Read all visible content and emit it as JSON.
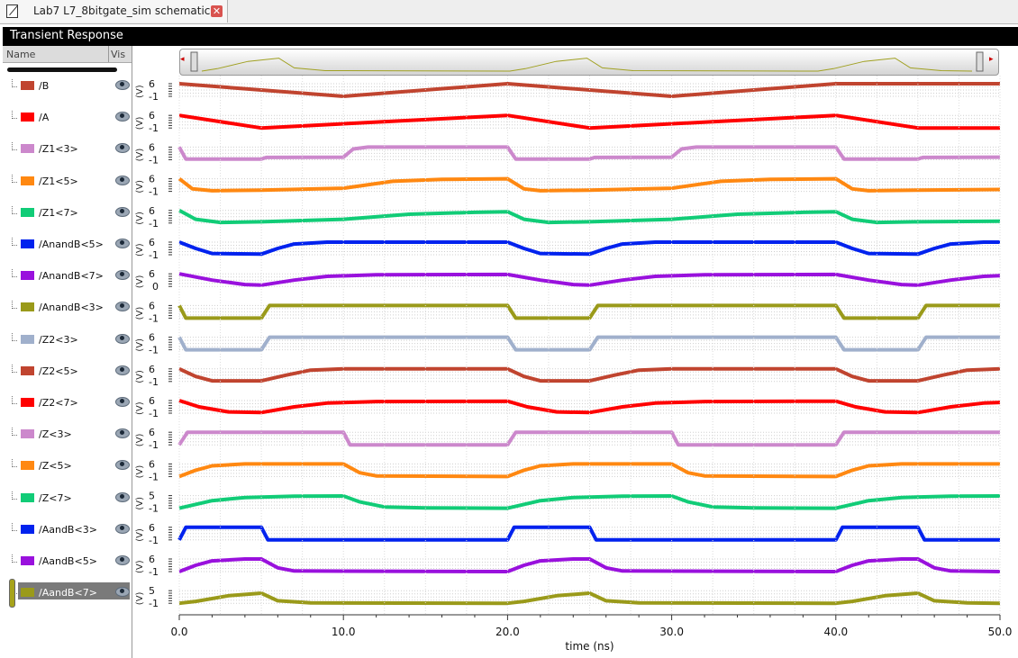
{
  "tab": {
    "title": "Lab7 L7_8bitgate_sim schematic",
    "close_label": "✕"
  },
  "panel": {
    "title": "Transient Response"
  },
  "sidebar": {
    "name_header": "Name",
    "vis_header": "Vis"
  },
  "overview": {
    "left_arrow": "◂",
    "right_arrow": "▸"
  },
  "y_unit": "(V)",
  "signals": [
    {
      "label": "/B",
      "color": "#c0442f",
      "ytick_top": "6",
      "ytick_bot": "-1",
      "kind": "digital",
      "wave": [
        [
          0,
          1
        ],
        [
          10,
          0
        ],
        [
          20,
          1
        ],
        [
          30,
          0
        ],
        [
          40,
          1
        ],
        [
          50,
          1
        ]
      ]
    },
    {
      "label": "/A",
      "color": "#ff0000",
      "ytick_top": "6",
      "ytick_bot": "-1",
      "kind": "digital",
      "wave": [
        [
          0,
          1
        ],
        [
          5,
          0
        ],
        [
          20,
          1
        ],
        [
          25,
          0
        ],
        [
          40,
          1
        ],
        [
          45,
          0
        ],
        [
          50,
          0
        ]
      ]
    },
    {
      "label": "/Z1<3>",
      "color": "#cc88cc",
      "ytick_top": "6",
      "ytick_bot": "-1",
      "kind": "analog",
      "wave": [
        [
          0,
          1
        ],
        [
          0.4,
          0.05
        ],
        [
          5,
          0.05
        ],
        [
          5.3,
          0.18
        ],
        [
          10,
          0.2
        ],
        [
          10.6,
          0.85
        ],
        [
          11.5,
          1
        ],
        [
          20,
          1
        ],
        [
          20.5,
          0.05
        ],
        [
          25,
          0.05
        ],
        [
          25.3,
          0.18
        ],
        [
          30,
          0.2
        ],
        [
          30.6,
          0.85
        ],
        [
          31.5,
          1
        ],
        [
          40,
          1
        ],
        [
          40.5,
          0.05
        ],
        [
          45,
          0.05
        ],
        [
          45.3,
          0.18
        ],
        [
          50,
          0.2
        ]
      ]
    },
    {
      "label": "/Z1<5>",
      "color": "#ff8811",
      "ytick_top": "6",
      "ytick_bot": "-1",
      "kind": "analog",
      "wave": [
        [
          0,
          1
        ],
        [
          0.8,
          0.2
        ],
        [
          2,
          0.05
        ],
        [
          5,
          0.1
        ],
        [
          10,
          0.25
        ],
        [
          13,
          0.8
        ],
        [
          16,
          0.95
        ],
        [
          20,
          1
        ],
        [
          21,
          0.2
        ],
        [
          22,
          0.05
        ],
        [
          25,
          0.1
        ],
        [
          30,
          0.25
        ],
        [
          33,
          0.8
        ],
        [
          36,
          0.95
        ],
        [
          40,
          1
        ],
        [
          41,
          0.2
        ],
        [
          42,
          0.05
        ],
        [
          45,
          0.1
        ],
        [
          50,
          0.15
        ]
      ]
    },
    {
      "label": "/Z1<7>",
      "color": "#11cc77",
      "ytick_top": "6",
      "ytick_bot": "-1",
      "kind": "analog",
      "wave": [
        [
          0,
          1
        ],
        [
          1,
          0.3
        ],
        [
          2.5,
          0.05
        ],
        [
          5,
          0.1
        ],
        [
          10,
          0.3
        ],
        [
          14,
          0.7
        ],
        [
          18,
          0.85
        ],
        [
          20,
          0.9
        ],
        [
          21,
          0.3
        ],
        [
          22.5,
          0.05
        ],
        [
          25,
          0.1
        ],
        [
          30,
          0.3
        ],
        [
          34,
          0.7
        ],
        [
          38,
          0.85
        ],
        [
          40,
          0.9
        ],
        [
          41,
          0.3
        ],
        [
          42.5,
          0.05
        ],
        [
          45,
          0.1
        ],
        [
          50,
          0.15
        ]
      ]
    },
    {
      "label": "/AnandB<5>",
      "color": "#0022ee",
      "ytick_top": "6",
      "ytick_bot": "-1",
      "kind": "analog",
      "wave": [
        [
          0,
          1
        ],
        [
          1,
          0.5
        ],
        [
          2,
          0.1
        ],
        [
          5,
          0.05
        ],
        [
          6,
          0.5
        ],
        [
          7,
          0.85
        ],
        [
          9,
          1
        ],
        [
          20,
          1
        ],
        [
          21,
          0.5
        ],
        [
          22,
          0.1
        ],
        [
          25,
          0.05
        ],
        [
          26,
          0.5
        ],
        [
          27,
          0.85
        ],
        [
          29,
          1
        ],
        [
          40,
          1
        ],
        [
          41,
          0.5
        ],
        [
          42,
          0.1
        ],
        [
          45,
          0.05
        ],
        [
          46,
          0.5
        ],
        [
          47,
          0.85
        ],
        [
          49,
          1
        ],
        [
          50,
          1
        ]
      ]
    },
    {
      "label": "/AnandB<7>",
      "color": "#9911dd",
      "ytick_top": "6",
      "ytick_bot": "0",
      "kind": "analog",
      "wave": [
        [
          0,
          1
        ],
        [
          2,
          0.5
        ],
        [
          4,
          0.15
        ],
        [
          5,
          0.1
        ],
        [
          7,
          0.5
        ],
        [
          9,
          0.8
        ],
        [
          12,
          0.92
        ],
        [
          20,
          0.95
        ],
        [
          22,
          0.5
        ],
        [
          24,
          0.15
        ],
        [
          25,
          0.1
        ],
        [
          27,
          0.5
        ],
        [
          29,
          0.8
        ],
        [
          32,
          0.92
        ],
        [
          40,
          0.95
        ],
        [
          42,
          0.5
        ],
        [
          44,
          0.15
        ],
        [
          45,
          0.1
        ],
        [
          47,
          0.5
        ],
        [
          49,
          0.8
        ],
        [
          50,
          0.85
        ]
      ]
    },
    {
      "label": "/AnandB<3>",
      "color": "#9a9a1a",
      "ytick_top": "6",
      "ytick_bot": "-1",
      "kind": "digital",
      "wave": [
        [
          0,
          1
        ],
        [
          0.4,
          0
        ],
        [
          5,
          0
        ],
        [
          5.5,
          1
        ],
        [
          20,
          1
        ],
        [
          20.5,
          0
        ],
        [
          25,
          0
        ],
        [
          25.5,
          1
        ],
        [
          40,
          1
        ],
        [
          40.5,
          0
        ],
        [
          45,
          0
        ],
        [
          45.5,
          1
        ],
        [
          50,
          1
        ]
      ]
    },
    {
      "label": "/Z2<3>",
      "color": "#a0b0cc",
      "ytick_top": "6",
      "ytick_bot": "-1",
      "kind": "digital",
      "wave": [
        [
          0,
          1
        ],
        [
          0.4,
          0
        ],
        [
          5,
          0
        ],
        [
          5.5,
          1
        ],
        [
          20,
          1
        ],
        [
          20.5,
          0
        ],
        [
          25,
          0
        ],
        [
          25.5,
          1
        ],
        [
          40,
          1
        ],
        [
          40.5,
          0
        ],
        [
          45,
          0
        ],
        [
          45.5,
          1
        ],
        [
          50,
          1
        ]
      ]
    },
    {
      "label": "/Z2<5>",
      "color": "#c0442f",
      "ytick_top": "6",
      "ytick_bot": "-1",
      "kind": "analog",
      "wave": [
        [
          0,
          1
        ],
        [
          1,
          0.4
        ],
        [
          2,
          0.05
        ],
        [
          5,
          0.05
        ],
        [
          6.5,
          0.5
        ],
        [
          8,
          0.9
        ],
        [
          10,
          1
        ],
        [
          20,
          1
        ],
        [
          21,
          0.4
        ],
        [
          22,
          0.05
        ],
        [
          25,
          0.05
        ],
        [
          26.5,
          0.5
        ],
        [
          28,
          0.9
        ],
        [
          30,
          1
        ],
        [
          40,
          1
        ],
        [
          41,
          0.4
        ],
        [
          42,
          0.05
        ],
        [
          45,
          0.05
        ],
        [
          46.5,
          0.5
        ],
        [
          48,
          0.9
        ],
        [
          50,
          1
        ]
      ]
    },
    {
      "label": "/Z2<7>",
      "color": "#ff0000",
      "ytick_top": "6",
      "ytick_bot": "-1",
      "kind": "analog",
      "wave": [
        [
          0,
          1
        ],
        [
          1.2,
          0.5
        ],
        [
          3,
          0.1
        ],
        [
          5,
          0.05
        ],
        [
          7,
          0.5
        ],
        [
          9,
          0.8
        ],
        [
          12,
          0.92
        ],
        [
          20,
          0.95
        ],
        [
          21.2,
          0.5
        ],
        [
          23,
          0.1
        ],
        [
          25,
          0.05
        ],
        [
          27,
          0.5
        ],
        [
          29,
          0.8
        ],
        [
          32,
          0.92
        ],
        [
          40,
          0.95
        ],
        [
          41.2,
          0.5
        ],
        [
          43,
          0.1
        ],
        [
          45,
          0.05
        ],
        [
          47,
          0.5
        ],
        [
          49,
          0.8
        ],
        [
          50,
          0.85
        ]
      ]
    },
    {
      "label": "/Z<3>",
      "color": "#cc88cc",
      "ytick_top": "6",
      "ytick_bot": "-1",
      "kind": "digital",
      "wave": [
        [
          0,
          0
        ],
        [
          0.5,
          1
        ],
        [
          10,
          1
        ],
        [
          10.4,
          0
        ],
        [
          20,
          0
        ],
        [
          20.5,
          1
        ],
        [
          30,
          1
        ],
        [
          30.4,
          0
        ],
        [
          40,
          0
        ],
        [
          40.5,
          1
        ],
        [
          50,
          1
        ]
      ]
    },
    {
      "label": "/Z<5>",
      "color": "#ff8811",
      "ytick_top": "6",
      "ytick_bot": "-1",
      "kind": "analog",
      "wave": [
        [
          0,
          0
        ],
        [
          1,
          0.5
        ],
        [
          2,
          0.85
        ],
        [
          4,
          1
        ],
        [
          10,
          1
        ],
        [
          11,
          0.3
        ],
        [
          12,
          0.05
        ],
        [
          20,
          0
        ],
        [
          21,
          0.5
        ],
        [
          22,
          0.85
        ],
        [
          24,
          1
        ],
        [
          30,
          1
        ],
        [
          31,
          0.3
        ],
        [
          32,
          0.05
        ],
        [
          40,
          0
        ],
        [
          41,
          0.5
        ],
        [
          42,
          0.85
        ],
        [
          44,
          1
        ],
        [
          50,
          1
        ]
      ]
    },
    {
      "label": "/Z<7>",
      "color": "#11cc77",
      "ytick_top": "5",
      "ytick_bot": "-1",
      "kind": "analog",
      "wave": [
        [
          0,
          0
        ],
        [
          2,
          0.6
        ],
        [
          4,
          0.85
        ],
        [
          7,
          0.95
        ],
        [
          10,
          0.97
        ],
        [
          11,
          0.5
        ],
        [
          12.5,
          0.1
        ],
        [
          15,
          0.02
        ],
        [
          20,
          0
        ],
        [
          22,
          0.6
        ],
        [
          24,
          0.85
        ],
        [
          27,
          0.95
        ],
        [
          30,
          0.97
        ],
        [
          31,
          0.5
        ],
        [
          32.5,
          0.1
        ],
        [
          35,
          0.02
        ],
        [
          40,
          0
        ],
        [
          42,
          0.6
        ],
        [
          44,
          0.85
        ],
        [
          47,
          0.95
        ],
        [
          50,
          0.97
        ]
      ]
    },
    {
      "label": "/AandB<3>",
      "color": "#0022ee",
      "ytick_top": "6",
      "ytick_bot": "-1",
      "kind": "digital",
      "wave": [
        [
          0,
          0
        ],
        [
          0.4,
          1
        ],
        [
          5,
          1
        ],
        [
          5.4,
          0
        ],
        [
          20,
          0
        ],
        [
          20.4,
          1
        ],
        [
          25,
          1
        ],
        [
          25.4,
          0
        ],
        [
          40,
          0
        ],
        [
          40.4,
          1
        ],
        [
          45,
          1
        ],
        [
          45.4,
          0
        ],
        [
          50,
          0
        ]
      ]
    },
    {
      "label": "/AandB<5>",
      "color": "#9911dd",
      "ytick_top": "6",
      "ytick_bot": "-1",
      "kind": "analog",
      "wave": [
        [
          0,
          0
        ],
        [
          1,
          0.5
        ],
        [
          2,
          0.85
        ],
        [
          4,
          1
        ],
        [
          5,
          1
        ],
        [
          6,
          0.3
        ],
        [
          7,
          0.05
        ],
        [
          20,
          0
        ],
        [
          21,
          0.5
        ],
        [
          22,
          0.85
        ],
        [
          24,
          1
        ],
        [
          25,
          1
        ],
        [
          26,
          0.3
        ],
        [
          27,
          0.05
        ],
        [
          40,
          0
        ],
        [
          41,
          0.5
        ],
        [
          42,
          0.85
        ],
        [
          44,
          1
        ],
        [
          45,
          1
        ],
        [
          46,
          0.3
        ],
        [
          47,
          0.05
        ],
        [
          50,
          0
        ]
      ]
    },
    {
      "label": "/AandB<7>",
      "color": "#9a9a1a",
      "ytick_top": "5",
      "ytick_bot": "-1",
      "kind": "analog",
      "selected": true,
      "wave": [
        [
          0,
          0
        ],
        [
          1,
          0.15
        ],
        [
          3,
          0.6
        ],
        [
          5,
          0.8
        ],
        [
          6,
          0.2
        ],
        [
          8,
          0.03
        ],
        [
          20,
          0
        ],
        [
          21,
          0.15
        ],
        [
          23,
          0.6
        ],
        [
          25,
          0.8
        ],
        [
          26,
          0.2
        ],
        [
          28,
          0.03
        ],
        [
          40,
          0
        ],
        [
          41,
          0.15
        ],
        [
          43,
          0.6
        ],
        [
          45,
          0.8
        ],
        [
          46,
          0.2
        ],
        [
          48,
          0.03
        ],
        [
          50,
          0
        ]
      ]
    }
  ],
  "chart_data": {
    "type": "line",
    "title": "Transient Response",
    "xlabel": "time (ns)",
    "x_ticks": [
      "0.0",
      "10.0",
      "20.0",
      "30.0",
      "40.0",
      "50.0"
    ],
    "xlim": [
      0,
      50
    ],
    "grid": true
  }
}
